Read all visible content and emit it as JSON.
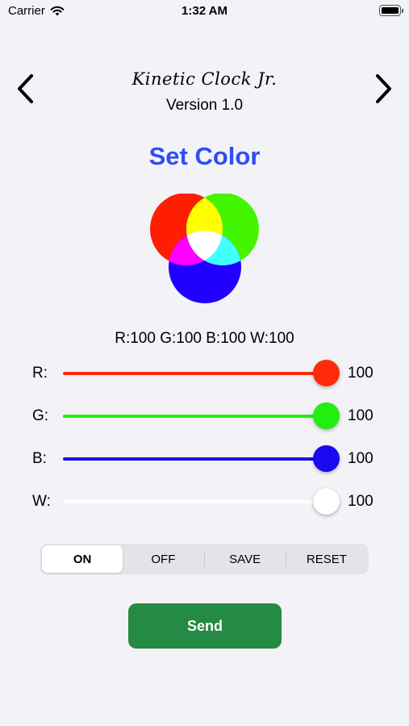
{
  "status_bar": {
    "carrier": "Carrier",
    "time": "1:32 AM",
    "wifi_icon": "wifi-icon",
    "battery_icon": "battery-full-icon"
  },
  "header": {
    "title": "Kinetic Clock Jr.",
    "version": "Version 1.0",
    "back_icon": "chevron-left-icon",
    "forward_icon": "chevron-right-icon"
  },
  "page_title": "Set Color",
  "color_preview": {
    "colors": {
      "red": "#ff1e00",
      "green": "#44f500",
      "blue": "#2200ff",
      "white": "#ffffff"
    }
  },
  "readout": "R:100 G:100 B:100 W:100",
  "sliders": [
    {
      "label": "R:",
      "value": "100",
      "level": 1.0,
      "color": "#ff2a0a"
    },
    {
      "label": "G:",
      "value": "100",
      "level": 1.0,
      "color": "#22ee10"
    },
    {
      "label": "B:",
      "value": "100",
      "level": 1.0,
      "color": "#1a0af0"
    },
    {
      "label": "W:",
      "value": "100",
      "level": 1.0,
      "color": "#ffffff"
    }
  ],
  "mode_control": {
    "segments": [
      "ON",
      "OFF",
      "SAVE",
      "RESET"
    ],
    "selected": "ON"
  },
  "send_button": "Send",
  "colors": {
    "accent": "#2d4ef5",
    "send": "#248a44",
    "background": "#f2f2f7"
  }
}
